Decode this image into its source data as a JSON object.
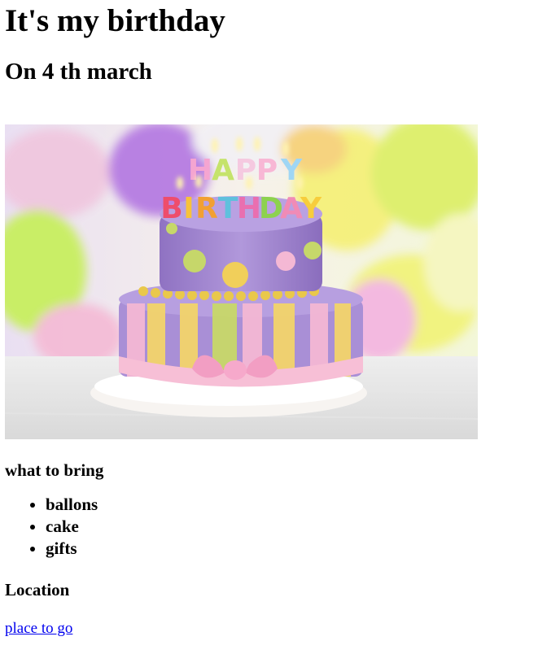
{
  "page": {
    "title": "It's my birthday",
    "subtitle": "On 4 th march"
  },
  "hero_image": {
    "subject": "birthday cake with balloons",
    "candle_text": "HAPPY BIRTHDAY"
  },
  "bring": {
    "heading": "what to bring",
    "items": [
      "ballons",
      "cake",
      "gifts"
    ]
  },
  "location": {
    "heading": "Location",
    "link_text": "place to go"
  },
  "colors": {
    "link": "#0000ee",
    "cake_purple": "#a58ad0",
    "cake_pink": "#f5b9cf"
  }
}
